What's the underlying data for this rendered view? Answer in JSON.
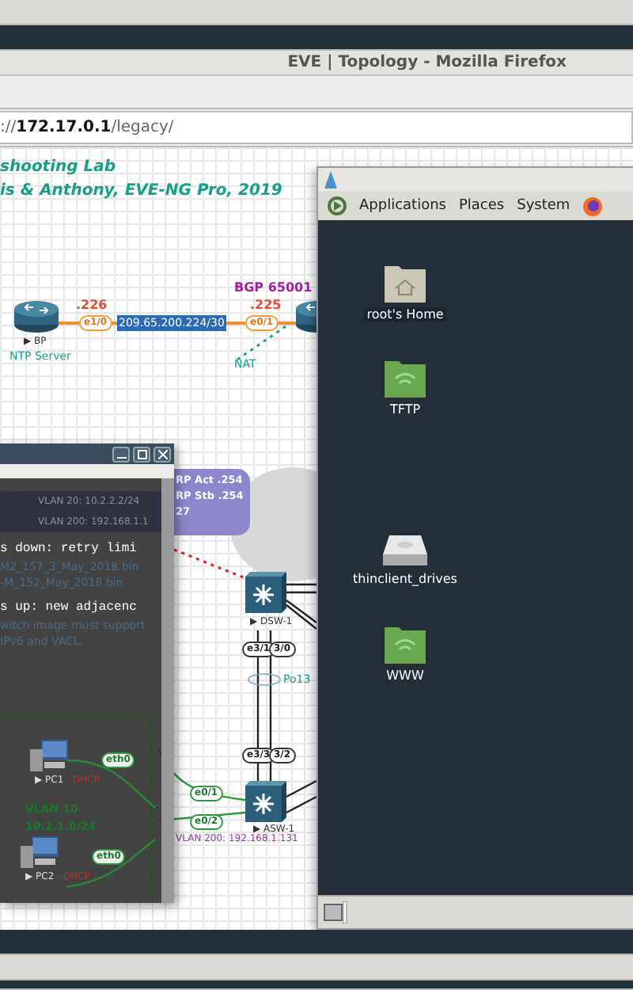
{
  "browser": {
    "title": "EVE | Topology - Mozilla Firefox",
    "url": "://**172.17.0.1**/legacy/"
  },
  "topology": {
    "heading": [
      "shooting Lab",
      "is & Anthony, EVE-NG Pro, 2019"
    ],
    "devices": [
      {
        "kind": "router",
        "name": "▶ BP"
      },
      {
        "kind": "router"
      },
      {
        "kind": "switch",
        "name": "▶ DSW-1"
      },
      {
        "kind": "switch",
        "name": "▶ ASW-1"
      }
    ],
    "notes": [
      {
        "kind": "caption",
        "text": "NTP Server"
      },
      {
        "kind": "ip",
        "text": ".226"
      },
      {
        "kind": "subnet",
        "text": "209.65.200.224/30"
      },
      {
        "kind": "bgp",
        "text": "BGP  65001"
      },
      {
        "kind": "ip",
        "text": ".225"
      },
      {
        "kind": "caption",
        "text": "NAT"
      },
      {
        "kind": "caption",
        "text": "Po13"
      },
      {
        "kind": "vlan",
        "text": "VLAN 200:  192.168.1.131"
      }
    ],
    "ports": [
      {
        "kind": "wan",
        "text": "e1/0"
      },
      {
        "kind": "wan",
        "text": "e0/1"
      },
      {
        "kind": "trunk",
        "text": "e3/1"
      },
      {
        "kind": "trunk",
        "text": "3/0"
      },
      {
        "kind": "trunk",
        "text": "e3/3"
      },
      {
        "kind": "trunk",
        "text": "3/2"
      },
      {
        "kind": "access",
        "text": "e0/1"
      },
      {
        "kind": "access",
        "text": "e0/2"
      }
    ],
    "callout": [
      "RP Act .254",
      "RP Stb .254",
      "27"
    ]
  },
  "console": {
    "lines": [
      {
        "kind": "faded",
        "text": "VLAN 20:    10.2.2.2/24"
      },
      {
        "kind": "faded",
        "text": "VLAN 200:  192.168.1.1"
      },
      {
        "kind": "terminal",
        "text": "s down: retry limi"
      },
      {
        "kind": "note",
        "text": "M2_157_3_May_2018.bin"
      },
      {
        "kind": "note",
        "text": "-M_152_May_2018.bin"
      },
      {
        "kind": "terminal",
        "text": "s up: new adjacenc"
      },
      {
        "kind": "note",
        "text": "witch image must support"
      },
      {
        "kind": "note",
        "text": "IPv6  and VACL."
      }
    ],
    "pcs": [
      {
        "name": "▶ PC1",
        "address": ".DHCP",
        "port": "eth0"
      },
      {
        "name": "▶ PC2",
        "address": ".DHCP",
        "port": "eth0"
      }
    ],
    "vlan": [
      "VLAN 10",
      "10.2.1.0/24"
    ]
  },
  "desktop": {
    "menu": [
      "Applications",
      "Places",
      "System"
    ],
    "icons": [
      {
        "kind": "home",
        "label": "root's Home"
      },
      {
        "kind": "share",
        "label": "TFTP"
      },
      {
        "kind": "drive",
        "label": "thinclient_drives"
      },
      {
        "kind": "share",
        "label": "WWW"
      }
    ]
  }
}
